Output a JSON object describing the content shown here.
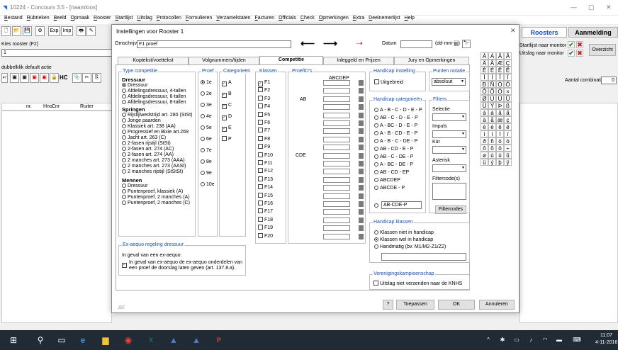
{
  "window": {
    "title": "10224 - Concours 3.5 - [naamloos]",
    "minimize": "—",
    "restore": "▢",
    "close": "✕"
  },
  "menu": [
    "Bestand",
    "Rubrieken",
    "Beeld",
    "Opmaak",
    "Rooster",
    "Startlijst",
    "Uitslag",
    "Protocollen",
    "Formulieren",
    "Verzamelstaten",
    "Facturen",
    "Officials",
    "Check",
    "Opmerkingen",
    "Extra",
    "Deelnemerlijst",
    "Help"
  ],
  "toolbar": {
    "exp_label": "Exp",
    "imp_label": "Imp"
  },
  "left": {
    "kies_label": "Kies rooster (F2)",
    "kies_value": "1",
    "dubbelklik": "dubbelklik default actie",
    "f7": "F7",
    "hc": "HC",
    "cols": [
      "nr.",
      "Hno",
      "Cnr",
      "Ruiter"
    ]
  },
  "right": {
    "tab_roosters": "Roosters",
    "tab_aanmelding": "Aanmelding",
    "startlijst": "Startlijst naar monitor",
    "uitslag": "Uitslag naar monitor",
    "overzicht": "Overzicht",
    "aantal": "Aantal combinaties",
    "aantal_value": "0"
  },
  "dialog": {
    "title": "Instellingen voor Rooster 1",
    "close": "✕",
    "omschrijving_label": "Omschrijving",
    "omschrijving_value": "F1 proef",
    "datum_label": "Datum",
    "datum_format": "(dd-mm-jjjj)",
    "tabs": [
      "Koptekst/voettekst",
      "Volgnummers/tijden",
      "Competitie",
      "Inleggeld en Prijzen",
      "Jury en Opmerkingen"
    ],
    "type_title": "Type competitie",
    "dressuur_head": "Dressuur",
    "dressuur": [
      "Dressuur",
      "Afdelingsdressuur, 4-tallen",
      "Afdelingsdressuur, 6-tallen",
      "Afdelingsdressuur, 8-tallen"
    ],
    "springen_head": "Springen",
    "springen": [
      "Rijstijlwedstrijd art. 280 (StSt)",
      "Jonge paarden",
      "Klassiek art. 238 (AA)",
      "Progressief en Bixie art.269",
      "Jacht art. 263 (C)",
      "2-fasen rijstijl (StSt)",
      "2-fasen art. 274 (AC)",
      "2-fasen art. 274 (AA)",
      "2 manches art. 273 (AAA)",
      "2 manches art. 273 (AASt)",
      "2 manches rijstijl (StStSt)"
    ],
    "mennen_head": "Mennen",
    "mennen": [
      "Dressuur",
      "Puntenproef, klassiek (A)",
      "Puntenproef, 2 manches (A)",
      "Puntenproef, 2 manches (C)"
    ],
    "proef_title": "Proef",
    "proef": [
      "1e",
      "2e",
      "3e",
      "4e",
      "5e",
      "6e",
      "7e",
      "8e",
      "9e",
      "10e"
    ],
    "cat_title": "Categorieën",
    "cats": [
      "A",
      "B",
      "C",
      "D",
      "E",
      "P"
    ],
    "klassen_title": "Klassen",
    "klassen": [
      "F1",
      "F2",
      "F3",
      "F4",
      "F5",
      "F6",
      "F7",
      "F8",
      "F9",
      "F10",
      "F11",
      "F12",
      "F13",
      "F14",
      "F15",
      "F16",
      "F17",
      "F18",
      "F19",
      "F20"
    ],
    "proefids_title": "ProefID's",
    "proefids_header": "ABCDEP",
    "proefid_ab": "AB",
    "proefid_cde": "CDE",
    "hc_inst_title": "Handicap instelling",
    "uitgebreid": "Uitgebreid",
    "punten_title": "Punten notatie",
    "punten_value": "absoluut",
    "hc_cat_title": "Handicap categorieën",
    "hc_cats": [
      "A - B - C - D - E - P",
      "AB - C - D - E - P",
      "A - BC - D - E - P",
      "A - B - CD - E - P",
      "A - B - C - DE - P",
      "AB - CD - E - P",
      "AB - C - DE - P",
      "A - BC - DE - P",
      "AB - CD - EP",
      "ABCDEP",
      "ABCDE - P"
    ],
    "hc_custom": "AB-CDE-P",
    "filters_title": "Filters",
    "selectie": "Selectie",
    "impuls": "Impuls",
    "kur": "Kür",
    "asterisk": "Asterisk",
    "filtercodes_label": "Filtercode(s)",
    "filtercodes_btn": "Filtercodes",
    "hc_klassen_title": "Handicap klassen",
    "hc_klassen": [
      "Klassen niet in handicap",
      "Klassen wel in handicap",
      "Handmatig (bv. M1/M2-Z1/Z2)"
    ],
    "ver_title": "Verenigingskampioenschap",
    "ver_check": "Uitslag niet verzenden naar de KNHS",
    "exaequo_title": "Ex-aequo regeling dressuur",
    "exaequo_text": "In geval van een ex-aequo:",
    "exaequo_check1": "In geval van ex-aequo de ex-aequo onderdelen van",
    "exaequo_check2": "een proef de doorslag laten geven (art. 137.8.a).",
    "help_btn": "?",
    "toepassen": "Toepassen",
    "ok": "OK",
    "annuleren": "Annuleren",
    "footer_code": "JBT"
  },
  "chars": [
    "À",
    "Á",
    "Â",
    "Ã",
    "Ä",
    "Å",
    "Æ",
    "Ç",
    "È",
    "É",
    "Ê",
    "Ë",
    "Ì",
    "Í",
    "Î",
    "Ï",
    "Ð",
    "Ñ",
    "Ò",
    "Ó",
    "Ô",
    "Õ",
    "Ö",
    "×",
    "Ø",
    "Ù",
    "Ú",
    "Û",
    "Ü",
    "Ý",
    "Þ",
    "ß",
    "à",
    "á",
    "â",
    "ã",
    "ä",
    "å",
    "æ",
    "ç",
    "è",
    "é",
    "ê",
    "ë",
    "ì",
    "í",
    "î",
    "ï",
    "ð",
    "ñ",
    "ò",
    "ó",
    "ô",
    "õ",
    "ö",
    "÷",
    "ø",
    "ù",
    "ú",
    "û",
    "ü",
    "ý",
    "þ",
    "ÿ"
  ],
  "taskbar": {
    "time": "11:07",
    "date": "4-11-2016"
  }
}
